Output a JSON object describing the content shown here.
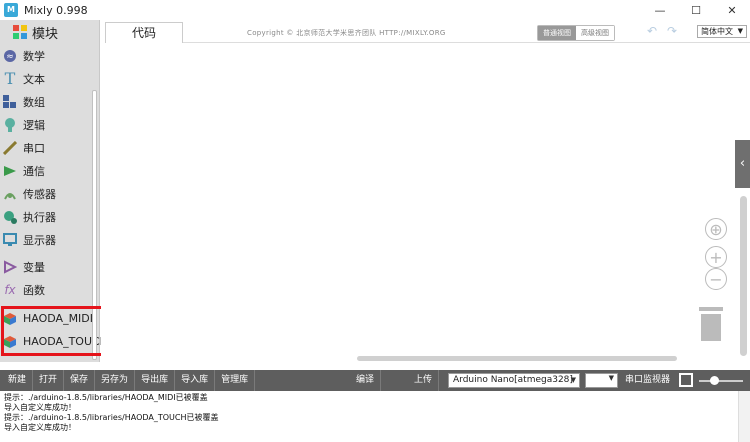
{
  "window": {
    "logo_text": "M",
    "title": "Mixly 0.998",
    "controls": {
      "minimize": "—",
      "maximize": "☐",
      "close": "✕"
    }
  },
  "sidebar": {
    "header": "模块",
    "categories": [
      {
        "label": "数学",
        "icon": "math-icon",
        "color": "#5b67a5"
      },
      {
        "label": "文本",
        "icon": "text-icon",
        "color": "#4a8fb0"
      },
      {
        "label": "数组",
        "icon": "array-icon",
        "color": "#3f5f9a"
      },
      {
        "label": "逻辑",
        "icon": "logic-icon",
        "color": "#5ab0a0"
      },
      {
        "label": "串口",
        "icon": "serial-icon",
        "color": "#8a7a30"
      },
      {
        "label": "通信",
        "icon": "communication-icon",
        "color": "#3a9a4a"
      },
      {
        "label": "传感器",
        "icon": "sensor-icon",
        "color": "#6aa060"
      },
      {
        "label": "执行器",
        "icon": "actuator-icon",
        "color": "#3aa080"
      },
      {
        "label": "显示器",
        "icon": "display-icon",
        "color": "#3a8ab0"
      },
      {
        "label": "变量",
        "icon": "variable-icon",
        "color": "#8a5aa0"
      },
      {
        "label": "函数",
        "icon": "function-icon",
        "color": "#9a6ab0"
      },
      {
        "label": "HAODA_MIDI",
        "icon": "cube-icon",
        "color": "#d03a2a"
      },
      {
        "label": "HAODA_TOUCH",
        "icon": "cube-icon",
        "color": "#d03a2a"
      }
    ]
  },
  "workspace": {
    "tab_label": "代码",
    "copyright": "Copyright © 北京师范大学米思齐团队 HTTP://MIXLY.ORG",
    "view_normal": "普通视图",
    "view_advanced": "高级视图",
    "undo": "↶",
    "redo": "↷",
    "language": "简体中文",
    "flyout_arrow": "‹",
    "recenter": "⊕",
    "zoom_in": "+",
    "zoom_out": "−"
  },
  "toolbar": {
    "buttons": [
      "新建",
      "打开",
      "保存",
      "另存为",
      "导出库",
      "导入库",
      "管理库"
    ],
    "compile": "编译",
    "upload": "上传",
    "board": "Arduino Nano[atmega328]",
    "port": "",
    "serial_monitor": "串口监视器"
  },
  "console": {
    "lines": [
      "提示：./arduino-1.8.5/libraries/HAODA_MIDI已被覆盖",
      "导入自定义库成功！",
      "提示：./arduino-1.8.5/libraries/HAODA_TOUCH已被覆盖",
      "导入自定义库成功！"
    ]
  }
}
